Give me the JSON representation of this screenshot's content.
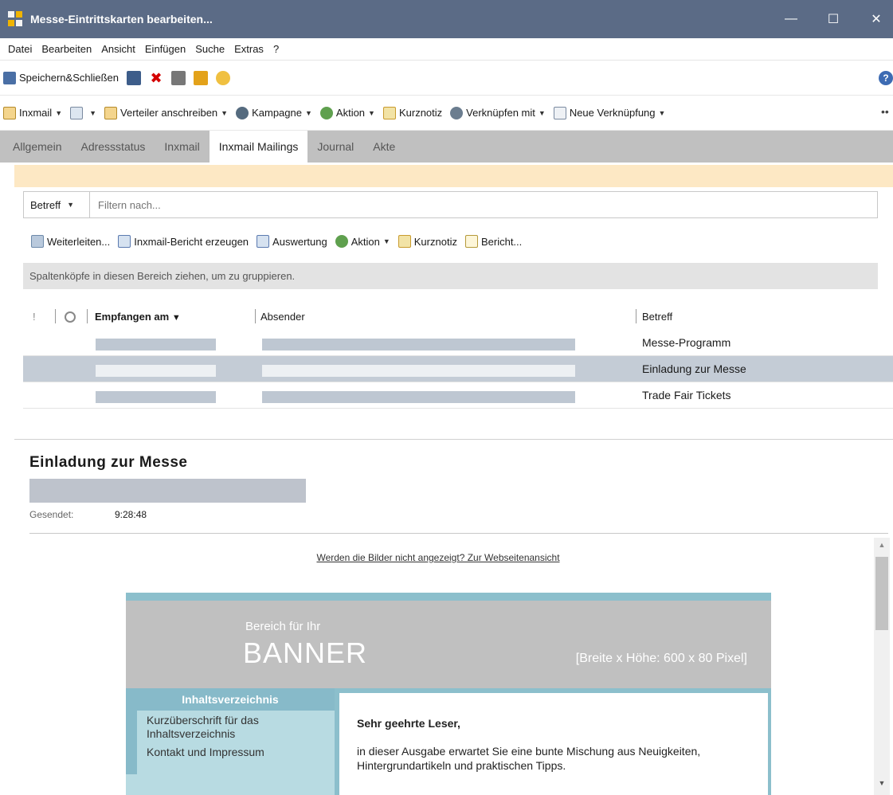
{
  "window": {
    "title": "Messe-Eintrittskarten bearbeiten..."
  },
  "menubar": [
    "Datei",
    "Bearbeiten",
    "Ansicht",
    "Einfügen",
    "Suche",
    "Extras",
    "?"
  ],
  "toolbar1": {
    "save_close": "Speichern&Schließen"
  },
  "toolbar2": {
    "inxmail": "Inxmail",
    "verteiler": "Verteiler anschreiben",
    "kampagne": "Kampagne",
    "aktion": "Aktion",
    "kurznotiz": "Kurznotiz",
    "verknuepfen": "Verknüpfen mit",
    "neue_verknuepfung": "Neue Verknüpfung"
  },
  "tabs": [
    "Allgemein",
    "Adressstatus",
    "Inxmail",
    "Inxmail Mailings",
    "Journal",
    "Akte"
  ],
  "filter": {
    "field": "Betreff",
    "placeholder": "Filtern nach..."
  },
  "toolbar3": {
    "weiterleiten": "Weiterleiten...",
    "bericht_erzeugen": "Inxmail-Bericht erzeugen",
    "auswertung": "Auswertung",
    "aktion": "Aktion",
    "kurznotiz": "Kurznotiz",
    "bericht": "Bericht..."
  },
  "groupbar": "Spaltenköpfe in diesen Bereich ziehen, um zu gruppieren.",
  "grid": {
    "headers": {
      "received": "Empfangen am",
      "sender": "Absender",
      "subject": "Betreff"
    },
    "rows": [
      {
        "subject": "Messe-Programm"
      },
      {
        "subject": "Einladung zur Messe"
      },
      {
        "subject": "Trade Fair Tickets"
      }
    ]
  },
  "message": {
    "title": "Einladung zur Messe",
    "sent_label": "Gesendet:",
    "sent_value": "9:28:48"
  },
  "preview": {
    "weblink": "Werden die Bilder nicht angezeigt? Zur Webseitenansicht",
    "banner_line1": "Bereich für Ihr",
    "banner_line2": "BANNER",
    "banner_line3": "[Breite x Höhe: 600 x 80 Pixel]",
    "toc_head": "Inhaltsverzeichnis",
    "toc_item1": "Kurzüberschrift für das Inhaltsverzeichnis",
    "toc_item2": "Kontakt und Impressum",
    "greeting": "Sehr geehrte Leser,",
    "intro": "in dieser Ausgabe erwartet Sie eine bunte Mischung aus Neuigkeiten, Hintergrundartikeln und praktischen Tipps."
  },
  "colors": {
    "titlebar": "#5b6b86",
    "tabbar": "#c0c0c0",
    "infobar": "#fde8c4",
    "accent": "#8cbfcc"
  }
}
